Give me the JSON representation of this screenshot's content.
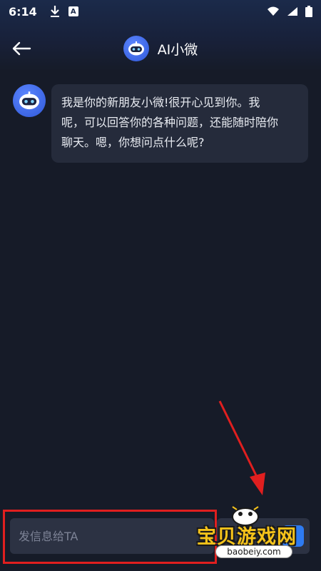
{
  "status_bar": {
    "time": "6:14",
    "icons": [
      "download-icon",
      "a-notification-icon",
      "wifi-icon",
      "signal-icon",
      "battery-icon"
    ],
    "a_label": "A"
  },
  "header": {
    "title": "AI小微",
    "back_icon": "back-arrow-icon",
    "avatar_icon": "robot-icon"
  },
  "chat": {
    "messages": [
      {
        "sender": "bot",
        "lines": [
          "我是你的新朋友小微!很开心见到你。我",
          "呢，可以回答你的各种问题，还能随时陪你",
          "聊天。嗯，你想问点什么呢?"
        ]
      }
    ]
  },
  "input": {
    "placeholder": "发信息给TA"
  },
  "watermark": {
    "text": "宝贝游戏网",
    "url": "baobeiy.com"
  },
  "colors": {
    "background": "#161b28",
    "bubble": "#252b3b",
    "accent": "#2e7bf2",
    "highlight": "#e01f1f"
  }
}
